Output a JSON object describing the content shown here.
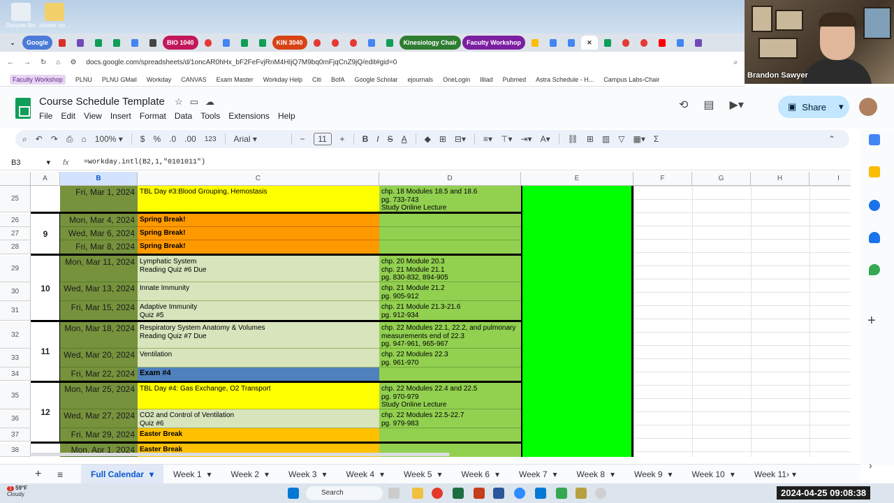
{
  "desktop": {
    "icons": [
      {
        "label": "Recycle Bin"
      },
      {
        "label": "iclicker clo..."
      }
    ]
  },
  "browser": {
    "tabs": [
      {
        "label": "Google",
        "color": "#4a7bd6"
      },
      {
        "label": "BIO 1040",
        "color": "#c2185b"
      },
      {
        "label": "KIN 3040",
        "color": "#d84315"
      },
      {
        "label": "Kinesiology Chair",
        "color": "#2e7d32"
      },
      {
        "label": "Faculty Workshop",
        "color": "#7b1fa2"
      }
    ],
    "url": "docs.google.com/spreadsheets/d/1oncAR0hHx_bF2FeFvjRnM4HIjQ7M9bq0mFjqCnZ9jQ/edit#gid=0",
    "bookmarks": [
      "Faculty Workshop",
      "PLNU",
      "PLNU GMail",
      "Workday",
      "CANVAS",
      "Exam Master",
      "Workday Help",
      "Citi",
      "BofA",
      "Google Scholar",
      "ejournals",
      "OneLogin",
      "Illiad",
      "Pubmed",
      "Astra Schedule - H...",
      "Campus Labs-Chair"
    ]
  },
  "webcam": {
    "name": "Brandon Sawyer"
  },
  "doc": {
    "title": "Course Schedule Template",
    "menu": [
      "File",
      "Edit",
      "View",
      "Insert",
      "Format",
      "Data",
      "Tools",
      "Extensions",
      "Help"
    ],
    "share_label": "Share"
  },
  "toolbar": {
    "zoom": "100%",
    "currency": "$",
    "percent": "%",
    "decimal_dec": ".0",
    "decimal_inc": ".00",
    "number_format": "123",
    "font": "Arial",
    "font_size": "11"
  },
  "formula": {
    "cell_ref": "B3",
    "fx": "fx",
    "text": "=workday.intl(B2,1,\"0101011\")"
  },
  "columns": [
    "A",
    "B",
    "C",
    "D",
    "E",
    "F",
    "G",
    "H",
    "I"
  ],
  "rows": [
    {
      "num": "25",
      "date": "Fri, Mar 1, 2024",
      "topic": "TBL Day #3:Blood Grouping, Hemostasis",
      "topic_color": "#ffff00",
      "reading": "chp. 18 Modules 18.5 and 18.6\npg. 733-743\nStudy Online Lecture"
    },
    {
      "num": "26",
      "date": "Mon, Mar 4, 2024",
      "topic": "Spring Break!",
      "topic_color": "#ff9900",
      "reading": ""
    },
    {
      "num": "27",
      "date": "Wed, Mar 6, 2024",
      "topic": "Spring Break!",
      "topic_color": "#ff9900",
      "reading": ""
    },
    {
      "num": "28",
      "date": "Fri, Mar 8, 2024",
      "topic": "Spring Break!",
      "topic_color": "#ff9900",
      "reading": ""
    },
    {
      "num": "29",
      "date": "Mon, Mar 11, 2024",
      "topic": "Lymphatic System\nReading Quiz #6 Due",
      "topic_color": "#d7e4bc",
      "reading": "chp. 20 Module 20.3\nchp. 21 Module 21.1\npg. 830-832, 894-905"
    },
    {
      "num": "30",
      "date": "Wed, Mar 13, 2024",
      "topic": "Innate Immunity",
      "topic_color": "#d7e4bc",
      "reading": "chp. 21 Module 21.2\npg. 905-912"
    },
    {
      "num": "31",
      "date": "Fri, Mar 15, 2024",
      "topic": "Adaptive Immunity\nQuiz #5",
      "topic_color": "#d7e4bc",
      "reading": "chp. 21 Module 21.3-21.6\npg. 912-934"
    },
    {
      "num": "32",
      "date": "Mon, Mar 18, 2024",
      "topic": "Respiratory System Anatomy & Volumes\n Reading Quiz #7 Due",
      "topic_color": "#d7e4bc",
      "reading": "chp. 22 Modules 22.1, 22.2, and pulmonary\nmeasurements end of 22.3\npg. 947-961, 965-967"
    },
    {
      "num": "33",
      "date": "Wed, Mar 20, 2024",
      "topic": "Ventilation",
      "topic_color": "#d7e4bc",
      "reading": "chp. 22 Modules 22.3\npg. 961-970"
    },
    {
      "num": "34",
      "date": "Fri, Mar 22, 2024",
      "topic": "Exam #4",
      "topic_color": "#4f81bd",
      "reading": ""
    },
    {
      "num": "35",
      "date": "Mon, Mar 25, 2024",
      "topic": "TBL Day #4: Gas Exchange, O2 Transport",
      "topic_color": "#ffff00",
      "reading": "chp. 22 Modules 22.4 and 22.5\npg. 970-979\nStudy Online Lecture"
    },
    {
      "num": "36",
      "date": "Wed, Mar 27, 2024",
      "topic": "CO2 and  Control of Ventilation\nQuiz #6",
      "topic_color": "#d7e4bc",
      "reading": "chp. 22  Modules 22.5-22.7\npg. 979-983"
    },
    {
      "num": "37",
      "date": "Fri, Mar 29, 2024",
      "topic": "Easter Break",
      "topic_color": "#ffc000",
      "reading": ""
    },
    {
      "num": "38",
      "date": "Mon, Apr 1, 2024",
      "topic": "Easter Break",
      "topic_color": "#ffc000",
      "reading": ""
    }
  ],
  "weeks": [
    "9",
    "10",
    "11",
    "12"
  ],
  "sheet_tabs": [
    "Full Calendar",
    "Week 1",
    "Week 2",
    "Week 3",
    "Week 4",
    "Week 5",
    "Week 6",
    "Week 7",
    "Week 8",
    "Week 9",
    "Week 10",
    "Week 11"
  ],
  "taskbar": {
    "weather_temp": "59°F",
    "weather_desc": "Cloudy",
    "weather_badge": "1",
    "search": "Search",
    "clock": "2024-04-25  09:08:38"
  }
}
